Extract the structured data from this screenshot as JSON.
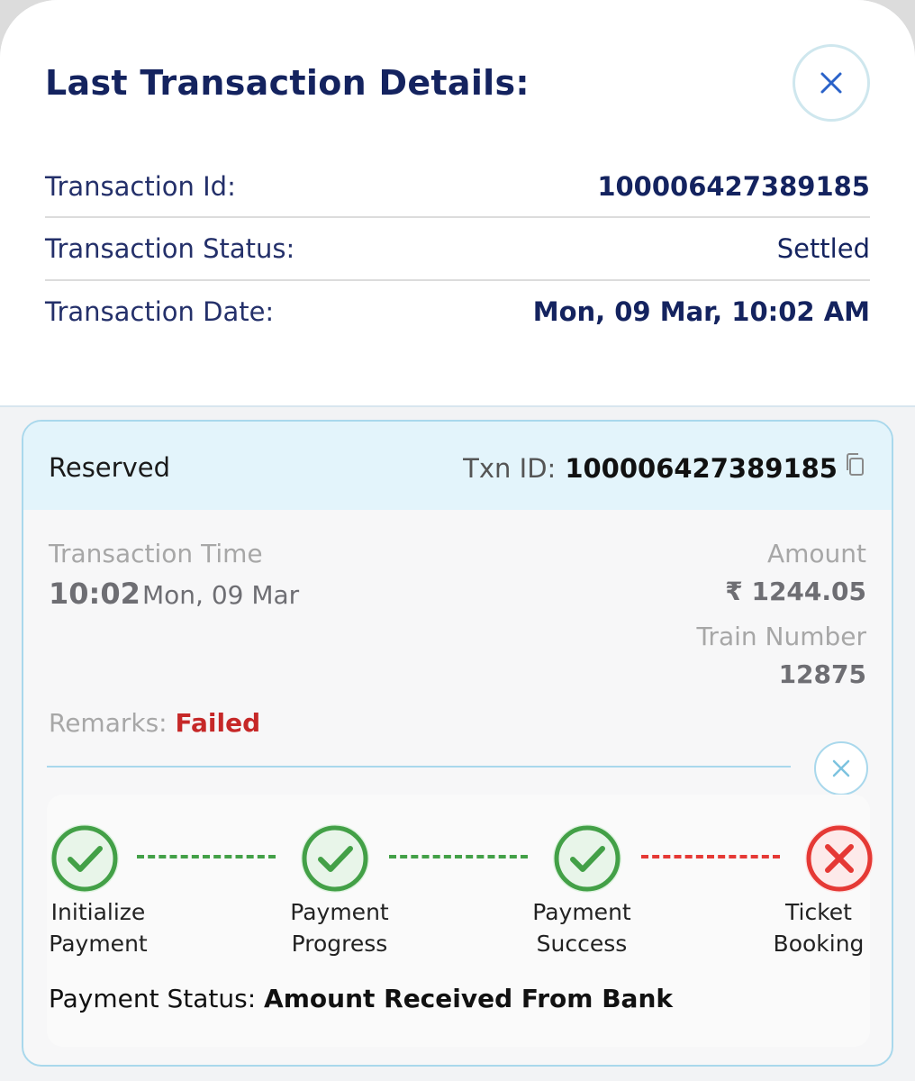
{
  "header": {
    "title": "Last Transaction Details:"
  },
  "details": [
    {
      "label": "Transaction Id:",
      "value": "100006427389185"
    },
    {
      "label": "Transaction Status:",
      "value": "Settled"
    },
    {
      "label": "Transaction Date:",
      "value": "Mon, 09 Mar, 10:02 AM"
    }
  ],
  "card": {
    "type": "Reserved",
    "txn_label": "Txn ID:",
    "txn_id": "100006427389185",
    "transaction_time_label": "Transaction Time",
    "time": "10:02",
    "date": "Mon, 09 Mar",
    "amount_label": "Amount",
    "amount": "₹ 1244.05",
    "train_number_label": "Train Number",
    "train_number": "12875",
    "remarks_label": "Remarks:",
    "remarks_value": "Failed",
    "payment_status_label": "Payment Status:",
    "payment_status_value": "Amount Received From Bank"
  },
  "steps": [
    {
      "line1": "Initialize",
      "line2": "Payment",
      "state": "success"
    },
    {
      "line1": "Payment",
      "line2": "Progress",
      "state": "success"
    },
    {
      "line1": "Payment",
      "line2": "Success",
      "state": "success"
    },
    {
      "line1": "Ticket",
      "line2": "Booking",
      "state": "failed"
    }
  ],
  "colors": {
    "title": "#14235f",
    "success": "#43a047",
    "failed": "#e53935",
    "accent_border": "#a9d8ec"
  }
}
